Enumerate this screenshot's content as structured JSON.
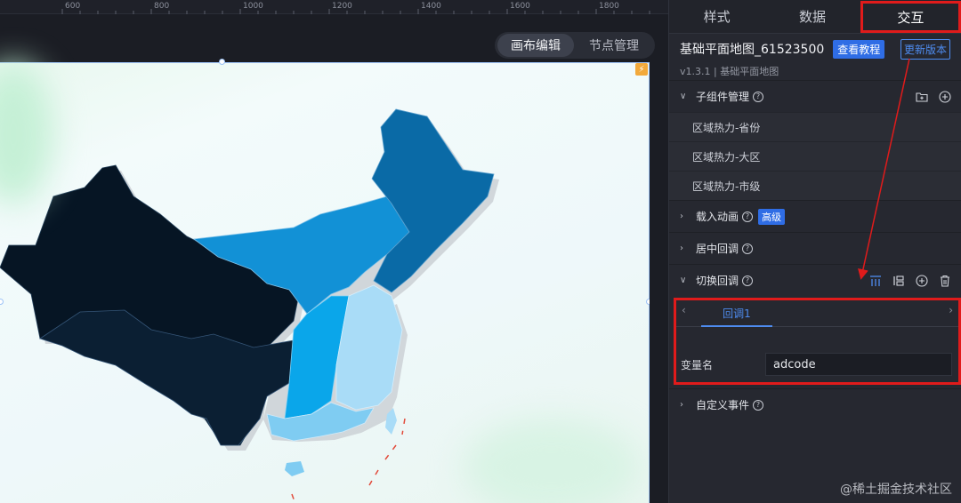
{
  "ruler": {
    "ticks": [
      "600",
      "800",
      "1000",
      "1200",
      "1400",
      "1600",
      "1800"
    ]
  },
  "toolbar": {
    "canvas_edit": "画布编辑",
    "node_manage": "节点管理"
  },
  "panel": {
    "tabs": [
      {
        "label": "样式"
      },
      {
        "label": "数据"
      },
      {
        "label": "交互"
      }
    ],
    "component": {
      "title": "基础平面地图_61523500",
      "tutorial_btn": "查看教程",
      "update_btn": "更新版本",
      "version": "v1.3.1 | 基础平面地图"
    },
    "sections": {
      "children": {
        "label": "子组件管理"
      },
      "load_anim": {
        "label": "载入动画",
        "badge": "高级"
      },
      "center_cb": {
        "label": "居中回调"
      },
      "switch_cb": {
        "label": "切换回调"
      },
      "custom_event": {
        "label": "自定义事件"
      }
    },
    "sub_items": [
      "区域热力-省份",
      "区域热力-大区",
      "区域热力-市级"
    ],
    "callback": {
      "tab_label": "回调1",
      "var_label": "变量名",
      "var_value": "adcode"
    }
  },
  "watermark": "@稀土掘金技术社区",
  "colors": {
    "highlight": "#e01b1b",
    "accent": "#2f6de5",
    "map_darkest": "#061524",
    "map_dark": "#0b1f33",
    "map_mid": "#0a6aa6",
    "map_blue": "#1291d6",
    "map_cyan": "#0aa6ea",
    "map_light": "#a9dcf7"
  }
}
